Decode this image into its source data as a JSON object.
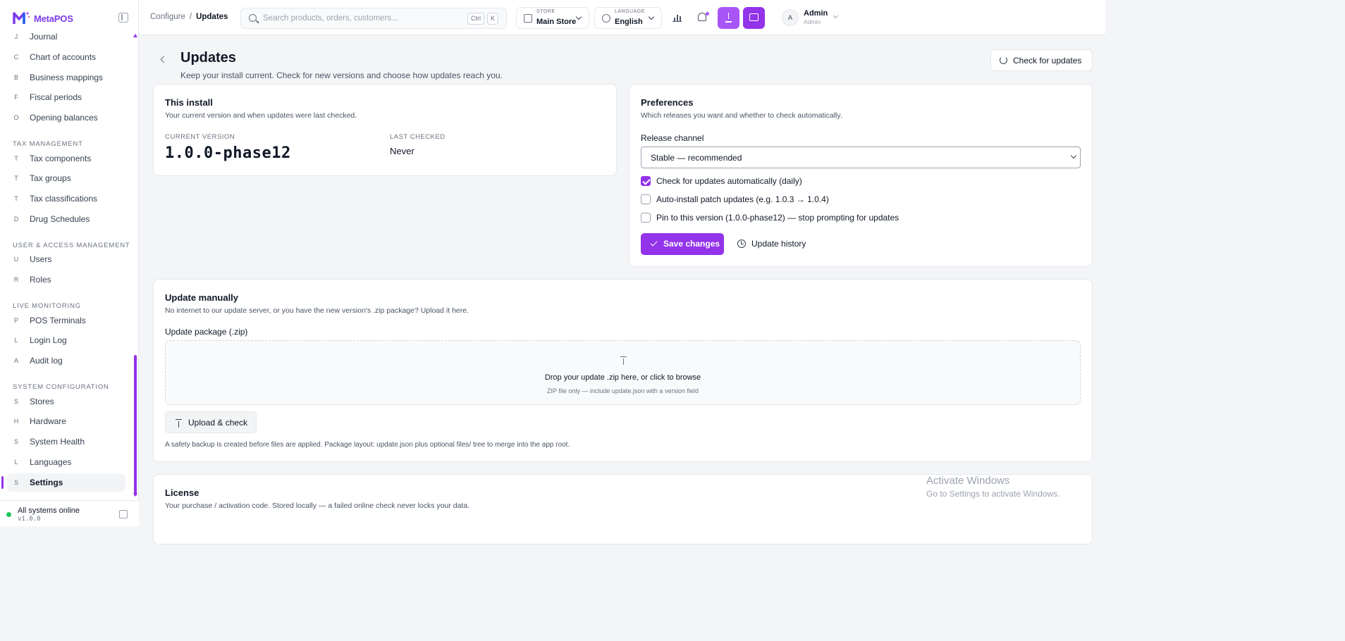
{
  "sidebar": {
    "brand": "MetaPOS",
    "groups": [
      {
        "title": "",
        "items": [
          {
            "letter": "J",
            "label": "Journal"
          },
          {
            "letter": "C",
            "label": "Chart of accounts"
          },
          {
            "letter": "B",
            "label": "Business mappings"
          },
          {
            "letter": "F",
            "label": "Fiscal periods"
          },
          {
            "letter": "O",
            "label": "Opening balances"
          }
        ]
      },
      {
        "title": "TAX MANAGEMENT",
        "items": [
          {
            "letter": "T",
            "label": "Tax components"
          },
          {
            "letter": "T",
            "label": "Tax groups"
          },
          {
            "letter": "T",
            "label": "Tax classifications"
          },
          {
            "letter": "D",
            "label": "Drug Schedules"
          }
        ]
      },
      {
        "title": "USER & ACCESS MANAGEMENT",
        "items": [
          {
            "letter": "U",
            "label": "Users"
          },
          {
            "letter": "R",
            "label": "Roles"
          }
        ]
      },
      {
        "title": "LIVE MONITORING",
        "items": [
          {
            "letter": "P",
            "label": "POS Terminals"
          },
          {
            "letter": "L",
            "label": "Login Log"
          },
          {
            "letter": "A",
            "label": "Audit log"
          }
        ]
      },
      {
        "title": "SYSTEM CONFIGURATION",
        "items": [
          {
            "letter": "S",
            "label": "Stores"
          },
          {
            "letter": "H",
            "label": "Hardware"
          },
          {
            "letter": "S",
            "label": "System Health"
          },
          {
            "letter": "L",
            "label": "Languages"
          },
          {
            "letter": "S",
            "label": "Settings"
          }
        ]
      }
    ],
    "active_item": "Settings",
    "status_text": "All systems online",
    "version": "v1.0.0",
    "status_color": "#22c55e"
  },
  "topbar": {
    "breadcrumb": [
      "Configure",
      "Updates"
    ],
    "search_placeholder": "Search products, orders, customers...",
    "kbd": [
      "Ctrl",
      "K"
    ],
    "store_caption": "STORE",
    "store_value": "Main Store",
    "language_caption": "LANGUAGE",
    "language_value": "English",
    "user_initial": "A",
    "user_name": "Admin",
    "user_role": "Admin",
    "icons": [
      "chart-icon",
      "bell-icon",
      "download-icon",
      "pos-icon"
    ]
  },
  "page": {
    "title": "Updates",
    "subtitle": "Keep your install current. Check for new versions and choose how updates reach you.",
    "check_button": "Check for updates"
  },
  "install_card": {
    "title": "This install",
    "desc": "Your current version and when updates were last checked.",
    "version_caption": "CURRENT VERSION",
    "version_value": "1.0.0-phase12",
    "checked_caption": "LAST CHECKED",
    "checked_value": "Never"
  },
  "prefs_card": {
    "title": "Preferences",
    "desc": "Which releases you want and whether to check automatically.",
    "channel_label": "Release channel",
    "channel_value": "Stable — recommended",
    "options": [
      {
        "label": "Check for updates automatically (daily)",
        "checked": true
      },
      {
        "label": "Auto-install patch updates (e.g. 1.0.3 → 1.0.4)",
        "checked": false
      },
      {
        "label": "Pin to this version (1.0.0-phase12) — stop prompting for updates",
        "checked": false
      }
    ],
    "save_label": "Save changes",
    "history_label": "Update history"
  },
  "manual_card": {
    "title": "Update manually",
    "desc": "No internet to our update server, or you have the new version's .zip package? Upload it here.",
    "package_label": "Update package (.zip)",
    "drop_main": "Drop your update .zip here, or click to browse",
    "drop_sub": "ZIP file only — include update.json with a version field",
    "upload_label": "Upload & check",
    "note": "A safety backup is created before files are applied. Package layout: update.json plus optional files/ tree to merge into the app root."
  },
  "license_card": {
    "title": "License",
    "desc": "Your purchase / activation code. Stored locally — a failed online check never locks your data."
  },
  "watermark": {
    "line1": "Activate Windows",
    "line2": "Go to Settings to activate Windows."
  },
  "colors": {
    "accent": "#9333ea",
    "accent_light": "#a855f7"
  }
}
